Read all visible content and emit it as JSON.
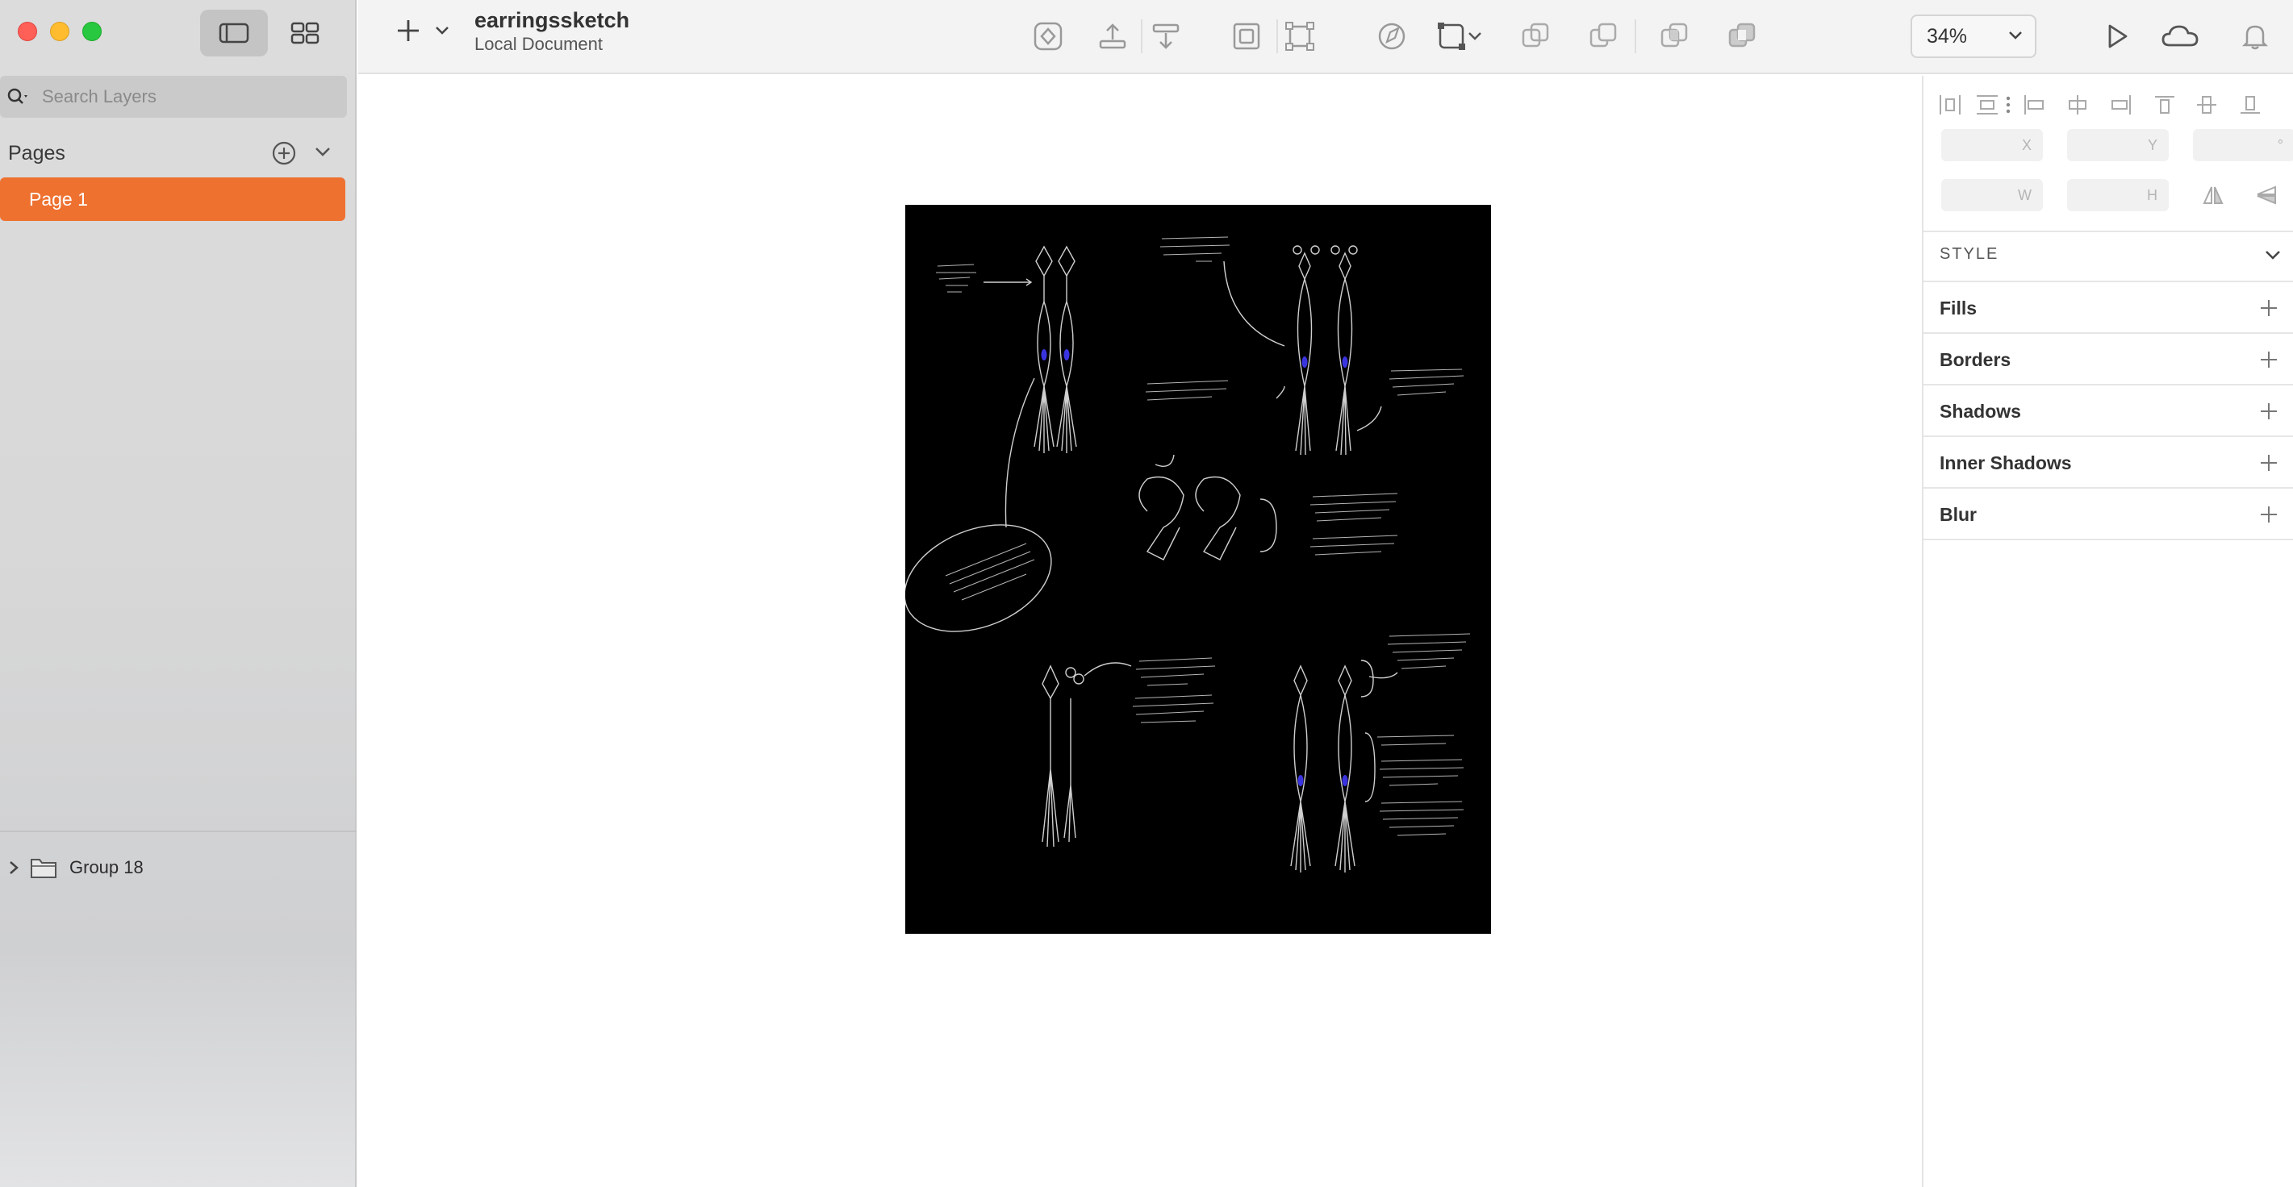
{
  "document": {
    "title": "earringssketch",
    "subtitle": "Local Document"
  },
  "sidebar": {
    "search_placeholder": "Search Layers",
    "pages_title": "Pages",
    "pages": [
      {
        "label": "Page 1",
        "selected": true
      }
    ],
    "layers": [
      {
        "label": "Group 18",
        "type": "group",
        "expanded": false
      }
    ]
  },
  "toolbar": {
    "zoom": "34%",
    "icons": [
      "create-symbol-icon",
      "forward-icon",
      "backward-icon",
      "mask-icon",
      "scale-icon",
      "edit-path-icon",
      "boolean-icon",
      "union-icon",
      "subtract-icon",
      "intersect-icon",
      "difference-icon",
      "preview-icon",
      "cloud-icon",
      "notifications-icon"
    ]
  },
  "inspector": {
    "fields": {
      "x": "X",
      "y": "Y",
      "rotation": "°",
      "w": "W",
      "h": "H"
    },
    "style_heading": "STYLE",
    "properties": [
      "Fills",
      "Borders",
      "Shadows",
      "Inner Shadows",
      "Blur"
    ]
  },
  "colors": {
    "accent": "#ee7130",
    "artboard_bg": "#000000",
    "sketch_line": "#cfcfcf",
    "gem_blue": "#3a34e0"
  }
}
